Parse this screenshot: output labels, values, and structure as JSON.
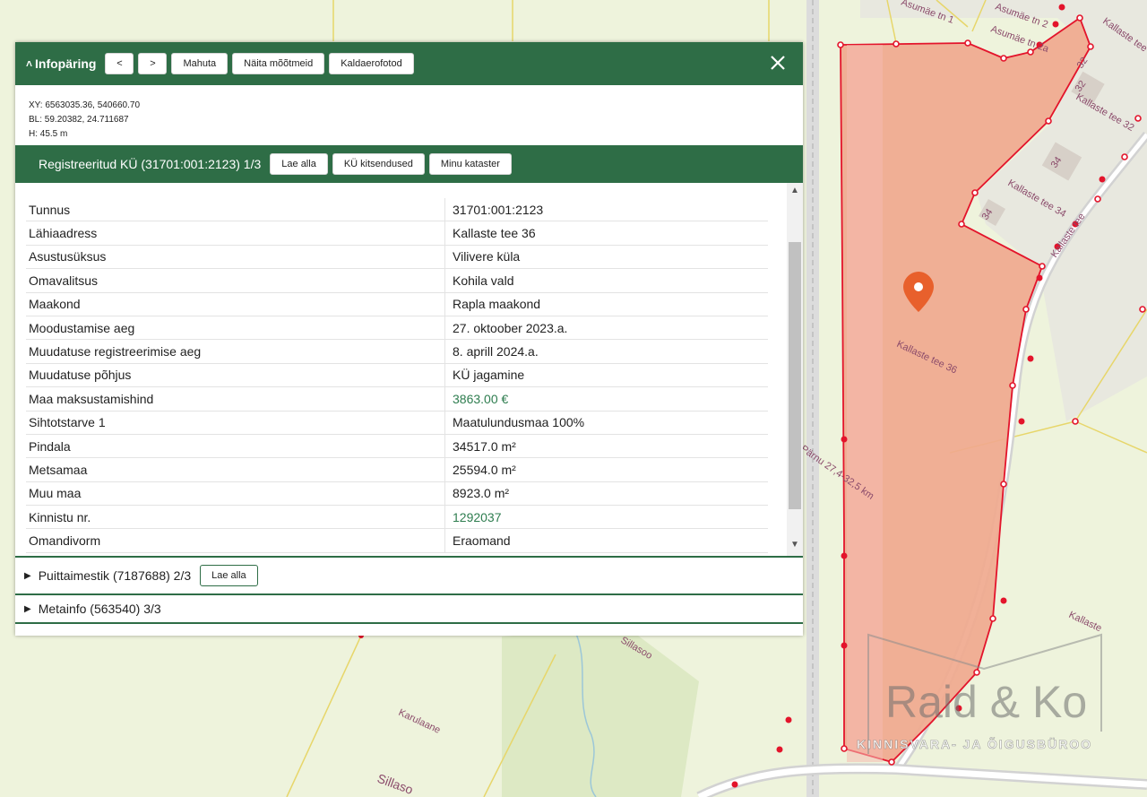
{
  "panel": {
    "title": "Infopäring",
    "prev_label": "<",
    "next_label": ">",
    "fit_label": "Mahuta",
    "measure_label": "Näita mõõtmeid",
    "aerial_label": "Kaldaerofotod",
    "close_icon": "close-icon"
  },
  "coords": {
    "xy": "XY: 6563035.36, 540660.70",
    "bl": "BL: 59.20382, 24.711687",
    "h": "H: 45.5 m"
  },
  "section": {
    "title": "Registreeritud KÜ (31701:001:2123) 1/3",
    "download_label": "Lae alla",
    "restrictions_label": "KÜ kitsendused",
    "cadastre_label": "Minu kataster"
  },
  "rows": [
    {
      "key": "Tunnus",
      "value": "31701:001:2123"
    },
    {
      "key": "Lähiaadress",
      "value": "Kallaste tee 36"
    },
    {
      "key": "Asustusüksus",
      "value": "Vilivere küla"
    },
    {
      "key": "Omavalitsus",
      "value": "Kohila vald"
    },
    {
      "key": "Maakond",
      "value": "Rapla maakond"
    },
    {
      "key": "Moodustamise aeg",
      "value": "27. oktoober 2023.a."
    },
    {
      "key": "Muudatuse registreerimise aeg",
      "value": "8. aprill 2024.a."
    },
    {
      "key": "Muudatuse põhjus",
      "value": "KÜ jagamine"
    },
    {
      "key": "Maa maksustamishind",
      "value": "3863.00 €"
    },
    {
      "key": "Sihtotstarve 1",
      "value": "Maatulundusmaa 100%"
    },
    {
      "key": "Pindala",
      "value": "34517.0 m²"
    },
    {
      "key": "Metsamaa",
      "value": "25594.0 m²"
    },
    {
      "key": "Muu maa",
      "value": "8923.0 m²"
    },
    {
      "key": "Kinnistu nr.",
      "value": "1292037"
    },
    {
      "key": "Omandivorm",
      "value": "Eraomand"
    }
  ],
  "accordion": {
    "item2_title": "Puittaimestik (7187688) 2/3",
    "item2_download": "Lae alla",
    "item3_title": "Metainfo (563540) 3/3"
  },
  "map": {
    "labels": {
      "asumae1": "Asumäe tn 1",
      "asumae2": "Asumäe tn 2",
      "asumae2a": "Asumäe tn 2a",
      "kallaste": "Kallaste tee",
      "kallaste32": "Kallaste tee 32",
      "kallaste34": "Kallaste tee 34",
      "kallaste36": "Kallaste tee 36",
      "kallaste_s": "Kallaste",
      "n32": "32",
      "n34": "34",
      "parnu": "Pärnu 27,4-32,5 km",
      "sillasoo": "Sillasoo",
      "karulaane": "Karulaane",
      "sillaso": "Sillaso"
    },
    "colors": {
      "parcel_fill": "#f0a98e",
      "parcel_line": "#e3142b",
      "header_green": "#2e6d46",
      "marker": "#e8602c"
    }
  },
  "watermark": {
    "name": "Raid & Ko",
    "tagline": "KINNISVARA- JA ÕIGUSBÜROO"
  }
}
